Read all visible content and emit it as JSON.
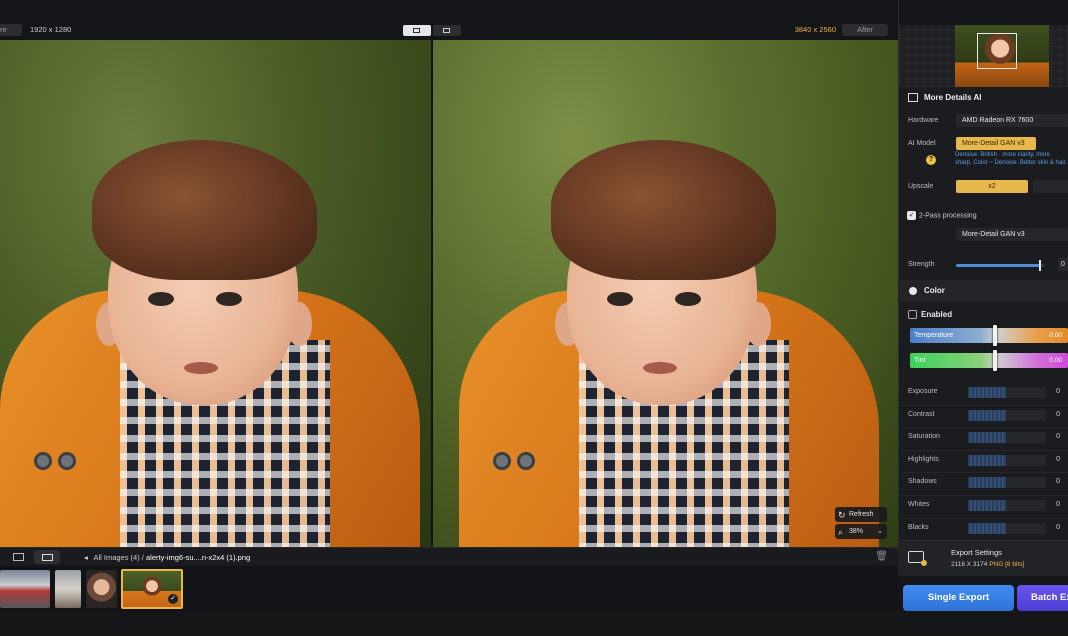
{
  "compare": {
    "before_tag": "re",
    "before_res": "1920 x 1280",
    "after_res": "3840 x 2560",
    "after_tag": "After"
  },
  "overlay": {
    "refresh_label": "Refresh",
    "zoom_value": "38%"
  },
  "bottombar": {
    "all_images": "All Images (4)",
    "separator": "/",
    "filename": "alerty-img6-su....n-x2x4 (1).png"
  },
  "panel": {
    "module_title": "More Details AI",
    "hardware_label": "Hardware",
    "hardware_value": "AMD Radeon RX 7600",
    "ai_model_label": "AI Model",
    "ai_model_value": "More-Detail GAN  v3",
    "ai_model_desc": "Denoise: British · more clarity, more sharp. Color ~ Denoise. Better skin & hair.",
    "upscale_label": "Upscale",
    "upscale_value": "x2",
    "twopass_label": "2-Pass processing",
    "twopass_model": "More-Detail GAN  v3",
    "strength_label": "Strength",
    "strength_value": "0",
    "strength_level": 0.95,
    "color_title": "Color",
    "enabled_label": "Enabled",
    "temperature_label": "Temperature",
    "temperature_value": "0.00",
    "tint_label": "Tint",
    "tint_value": "0.00",
    "adjustments": [
      {
        "label": "Exposure",
        "value": "0"
      },
      {
        "label": "Contrast",
        "value": "0"
      },
      {
        "label": "Saturation",
        "value": "0"
      },
      {
        "label": "Highlights",
        "value": "0"
      },
      {
        "label": "Shadows",
        "value": "0"
      },
      {
        "label": "Whites",
        "value": "0"
      },
      {
        "label": "Blacks",
        "value": "0"
      }
    ],
    "export_title": "Export Settings",
    "export_dims": "2116 X 3174",
    "export_format": "PNG",
    "export_bits": "[8 bits]",
    "single_export": "Single Export",
    "batch_export": "Batch Ex"
  },
  "colors": {
    "accent_gold": "#e7b84e",
    "accent_blue": "#3f8df0",
    "accent_purple": "#6a55f0"
  },
  "icons": [
    "refresh-icon",
    "zoom-icon",
    "grid-view-icon",
    "filmstrip-view-icon",
    "back-arrow-icon",
    "trash-icon",
    "check-icon",
    "help-icon",
    "module-icon",
    "color-icon",
    "export-icon"
  ]
}
